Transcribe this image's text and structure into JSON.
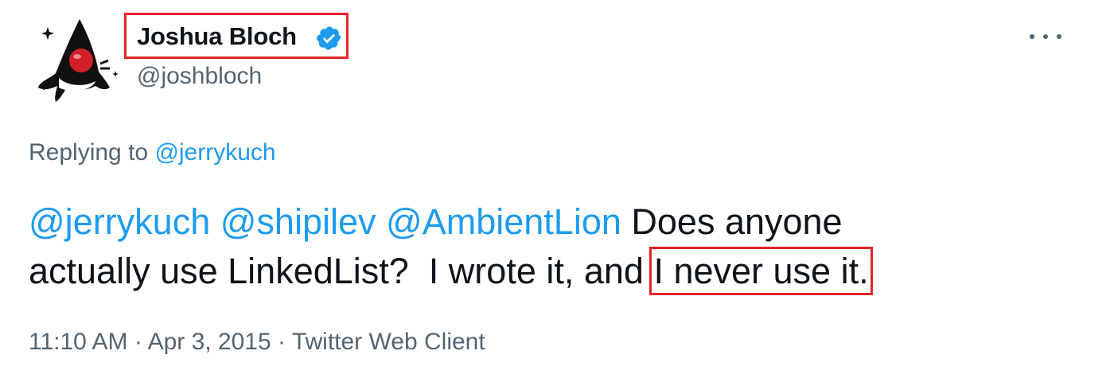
{
  "tweet": {
    "author": {
      "display_name": "Joshua Bloch",
      "handle": "@joshbloch",
      "verified": true,
      "avatar_icon": "duke-mascot-icon"
    },
    "more_icon": "more-options-icon",
    "replying_to": {
      "prefix": "Replying to",
      "user": "@jerrykuch"
    },
    "body": {
      "mentions": [
        "@jerrykuch",
        "@shipilev",
        "@AmbientLion"
      ],
      "line1_text": "Does anyone",
      "line2_text": "actually use LinkedList?  I wrote it, and",
      "highlighted_text": "I never use it."
    },
    "meta": {
      "time": "11:10 AM",
      "date": "Apr 3, 2015",
      "client": "Twitter Web Client",
      "separator": "·"
    }
  },
  "colors": {
    "link": "#1d9bf0",
    "secondary_text": "#536471",
    "highlight_box": "#e3242b",
    "primary_text": "#0f1419"
  }
}
